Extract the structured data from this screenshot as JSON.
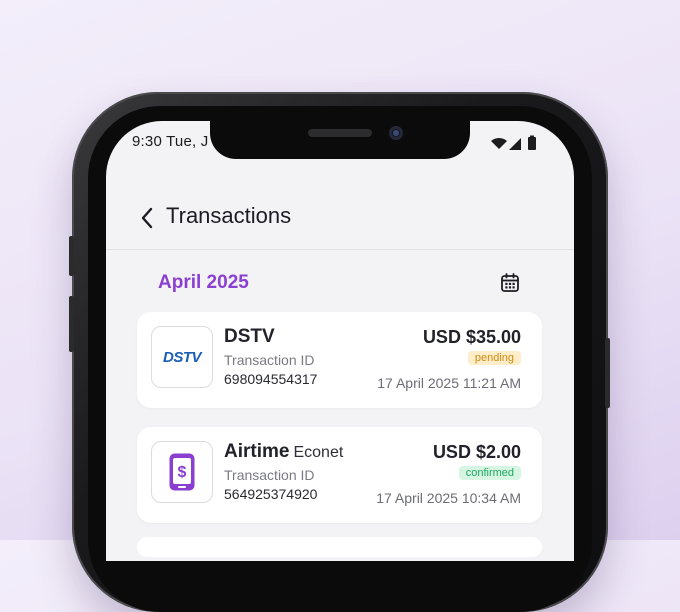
{
  "status_bar": {
    "time": "9:30  Tue, J"
  },
  "header": {
    "title": "Transactions"
  },
  "section": {
    "month": "April 2025"
  },
  "transactions": [
    {
      "name": "DSTV",
      "provider": "",
      "logo": "DSTV",
      "id_label": "Transaction ID",
      "id": "698094554317",
      "amount": "USD $35.00",
      "status": "pending",
      "datetime": "17 April 2025  11:21 AM"
    },
    {
      "name": "Airtime",
      "provider": "Econet",
      "logo": "phone-dollar-icon",
      "id_label": "Transaction ID",
      "id": "564925374920",
      "amount": "USD $2.00",
      "status": "confirmed",
      "datetime": "17 April 2025 10:34 AM"
    }
  ],
  "colors": {
    "accent": "#8a3fd1",
    "pending_bg": "#fdeec9",
    "pending_text": "#d08a14",
    "confirmed_bg": "#d6f5e3",
    "confirmed_text": "#1fa661"
  },
  "icons": {
    "back": "chevron-left-icon",
    "calendar": "calendar-icon",
    "wifi": "wifi-icon",
    "signal": "signal-icon",
    "battery": "battery-icon"
  }
}
